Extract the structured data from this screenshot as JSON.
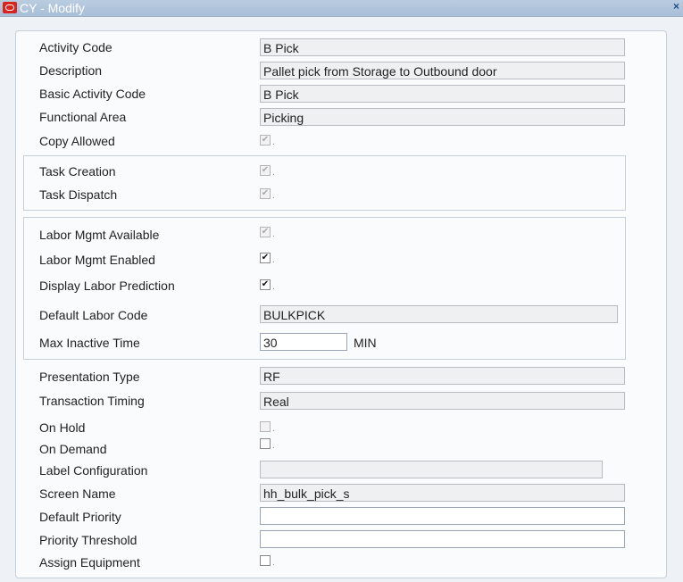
{
  "window": {
    "title": "CY - Modify",
    "close_glyph": "×",
    "logo_icon": "oracle-logo-icon"
  },
  "fields": {
    "activity_code": {
      "label": "Activity Code",
      "value": "B Pick"
    },
    "description": {
      "label": "Description",
      "value": "Pallet pick from Storage to Outbound door"
    },
    "basic_activity_code": {
      "label": "Basic Activity Code",
      "value": "B Pick"
    },
    "functional_area": {
      "label": "Functional Area",
      "value": "Picking"
    },
    "copy_allowed": {
      "label": "Copy Allowed",
      "checked": true,
      "enabled": false
    },
    "task_creation": {
      "label": "Task Creation",
      "checked": true,
      "enabled": false
    },
    "task_dispatch": {
      "label": "Task Dispatch",
      "checked": true,
      "enabled": false
    },
    "labor_mgmt_available": {
      "label": "Labor Mgmt Available",
      "checked": true,
      "enabled": false
    },
    "labor_mgmt_enabled": {
      "label": "Labor Mgmt Enabled",
      "checked": true,
      "enabled": true
    },
    "display_labor_prediction": {
      "label": "Display Labor Prediction",
      "checked": true,
      "enabled": true
    },
    "default_labor_code": {
      "label": "Default Labor Code",
      "value": "BULKPICK"
    },
    "max_inactive_time": {
      "label": "Max Inactive Time",
      "value": "30",
      "unit": "MIN"
    },
    "presentation_type": {
      "label": "Presentation Type",
      "value": "RF"
    },
    "transaction_timing": {
      "label": "Transaction Timing",
      "value": "Real"
    },
    "on_hold": {
      "label": "On Hold",
      "checked": false,
      "enabled": false
    },
    "on_demand": {
      "label": "On Demand",
      "checked": false,
      "enabled": true
    },
    "label_configuration": {
      "label": "Label Configuration",
      "value": ""
    },
    "screen_name": {
      "label": "Screen Name",
      "value": "hh_bulk_pick_s"
    },
    "default_priority": {
      "label": "Default Priority",
      "value": ""
    },
    "priority_threshold": {
      "label": "Priority Threshold",
      "value": ""
    },
    "assign_equipment": {
      "label": "Assign Equipment",
      "checked": false,
      "enabled": true
    }
  },
  "checkmark_glyph": "✔",
  "dot_glyph": "."
}
